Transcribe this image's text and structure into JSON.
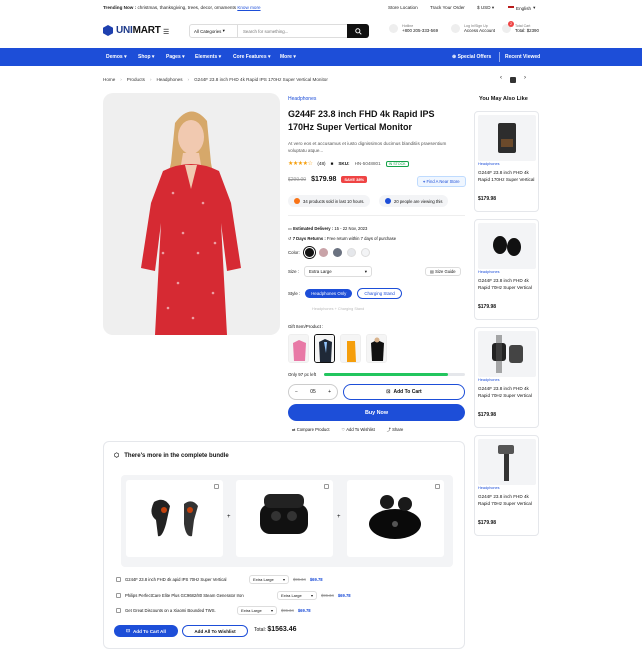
{
  "topbar": {
    "trending_label": "Trending Now :",
    "trending_items": "christmas, thanksgiving, trees, decor, ornaments",
    "know_more": "Know more",
    "store_location": "Store Location",
    "track_order": "Track Your Order",
    "currency": "$ USD",
    "language": "English"
  },
  "header": {
    "logo_main": "UNI",
    "logo_rest": "MART",
    "category": "All Categories",
    "search_placeholder": "Search for something...",
    "hotline_label": "Hotline",
    "hotline_value": "+800 205-333-569",
    "account_label": "Log In/Sign Up",
    "account_value": "Access Account",
    "cart_label": "Total Cart",
    "cart_value": "Total: $2390",
    "cart_count": "2"
  },
  "nav": {
    "items": [
      "Demos",
      "Shop",
      "Pages",
      "Elements",
      "Core Features",
      "More"
    ],
    "special": "Special Offers",
    "recent": "Recent Viewed"
  },
  "breadcrumb": [
    "Home",
    "Products",
    "Headphones",
    "G244F 23.8 inch FHD 4k Rapid IPS 170Hz Super Vertical Monitor"
  ],
  "product": {
    "category": "Headphones",
    "title": "G244F 23.8 inch FHD 4k Rapid IPS 170Hz Super Vertical Monitor",
    "description": "At vero eos et accusamus et iusto dignissimos ducimus blanditiis praesentium voluptatu atque...",
    "reviews": "(48)",
    "sku_label": "SKU:",
    "sku": "HN-5048801",
    "stock": "IN STOCK",
    "old_price": "$299.00",
    "new_price": "$179.98",
    "sale": "SAVE 38%",
    "find_store": "Find A Near Store",
    "sold": "34 products sold in last 10 hours.",
    "viewing": "20 people are viewing this",
    "delivery_label": "Estimated Delivery :",
    "delivery_value": "15 - 22 Nov, 2023",
    "returns_label": "7 Days Returns :",
    "returns_value": "Free return within 7 days of purchase",
    "color_label": "Color:",
    "colors": [
      "#111111",
      "#c9a3a8",
      "#6b7280",
      "#e5e7eb",
      "#f3f4f6"
    ],
    "size_label": "Size :",
    "size_value": "Extra Large",
    "size_guide": "Size Guide",
    "style_label": "Style :",
    "style_on": "Headphones Only",
    "style_off": "Charging Stand",
    "style_faint": "Headphones + Charging Stand",
    "gift_label": "Gift Item/Product :",
    "stock_left": "Only 97 pc left",
    "stock_fraction": 0.88,
    "qty": "05",
    "add_cart": "Add To Cart",
    "buy_now": "Buy Now",
    "compare": "Compare Product",
    "wishlist": "Add To Wishlist",
    "share": "Share"
  },
  "sidebar": {
    "title": "You May Also Like",
    "cards": [
      {
        "category": "Headphones",
        "name": "G244F 23.8 inch FHD 4k Rapid 170Hz Super Vertical",
        "price": "$179.98"
      },
      {
        "category": "Headphones",
        "name": "G244F 23.8 inch FHD 4k Rapid 70Hz Super Vertical",
        "price": "$179.98"
      },
      {
        "category": "Headphones",
        "name": "G244F 23.8 inch FHD 4k Rapid 70Hz Super Vertical",
        "price": "$179.98"
      },
      {
        "category": "Headphones",
        "name": "G244F 23.8 inch FHD 4k Rapid 70Hz Super Vertical",
        "price": "$179.98"
      }
    ]
  },
  "bundle": {
    "title": "There's more in the complete bundle",
    "rows": [
      {
        "name": "G244F 23.8 inch FHD 4k apid IPS 70Hz Super Vertical",
        "size": "Extra Large",
        "old": "$96.34",
        "new": "$69.78"
      },
      {
        "name": "Philips PerfectCare Elite Plus GC9682/80 Steam Generator Iron",
        "size": "Extra Large",
        "old": "$96.34",
        "new": "$69.78"
      },
      {
        "name": "Get Great Discounts on a Xiaomi Bounded TWS.",
        "size": "Extra Large",
        "old": "$96.34",
        "new": "$69.78"
      }
    ],
    "add_all_cart": "Add To Cart All",
    "add_all_wish": "Add All To Wishlist",
    "total_label": "Total:",
    "total_value": "$1563.46"
  }
}
